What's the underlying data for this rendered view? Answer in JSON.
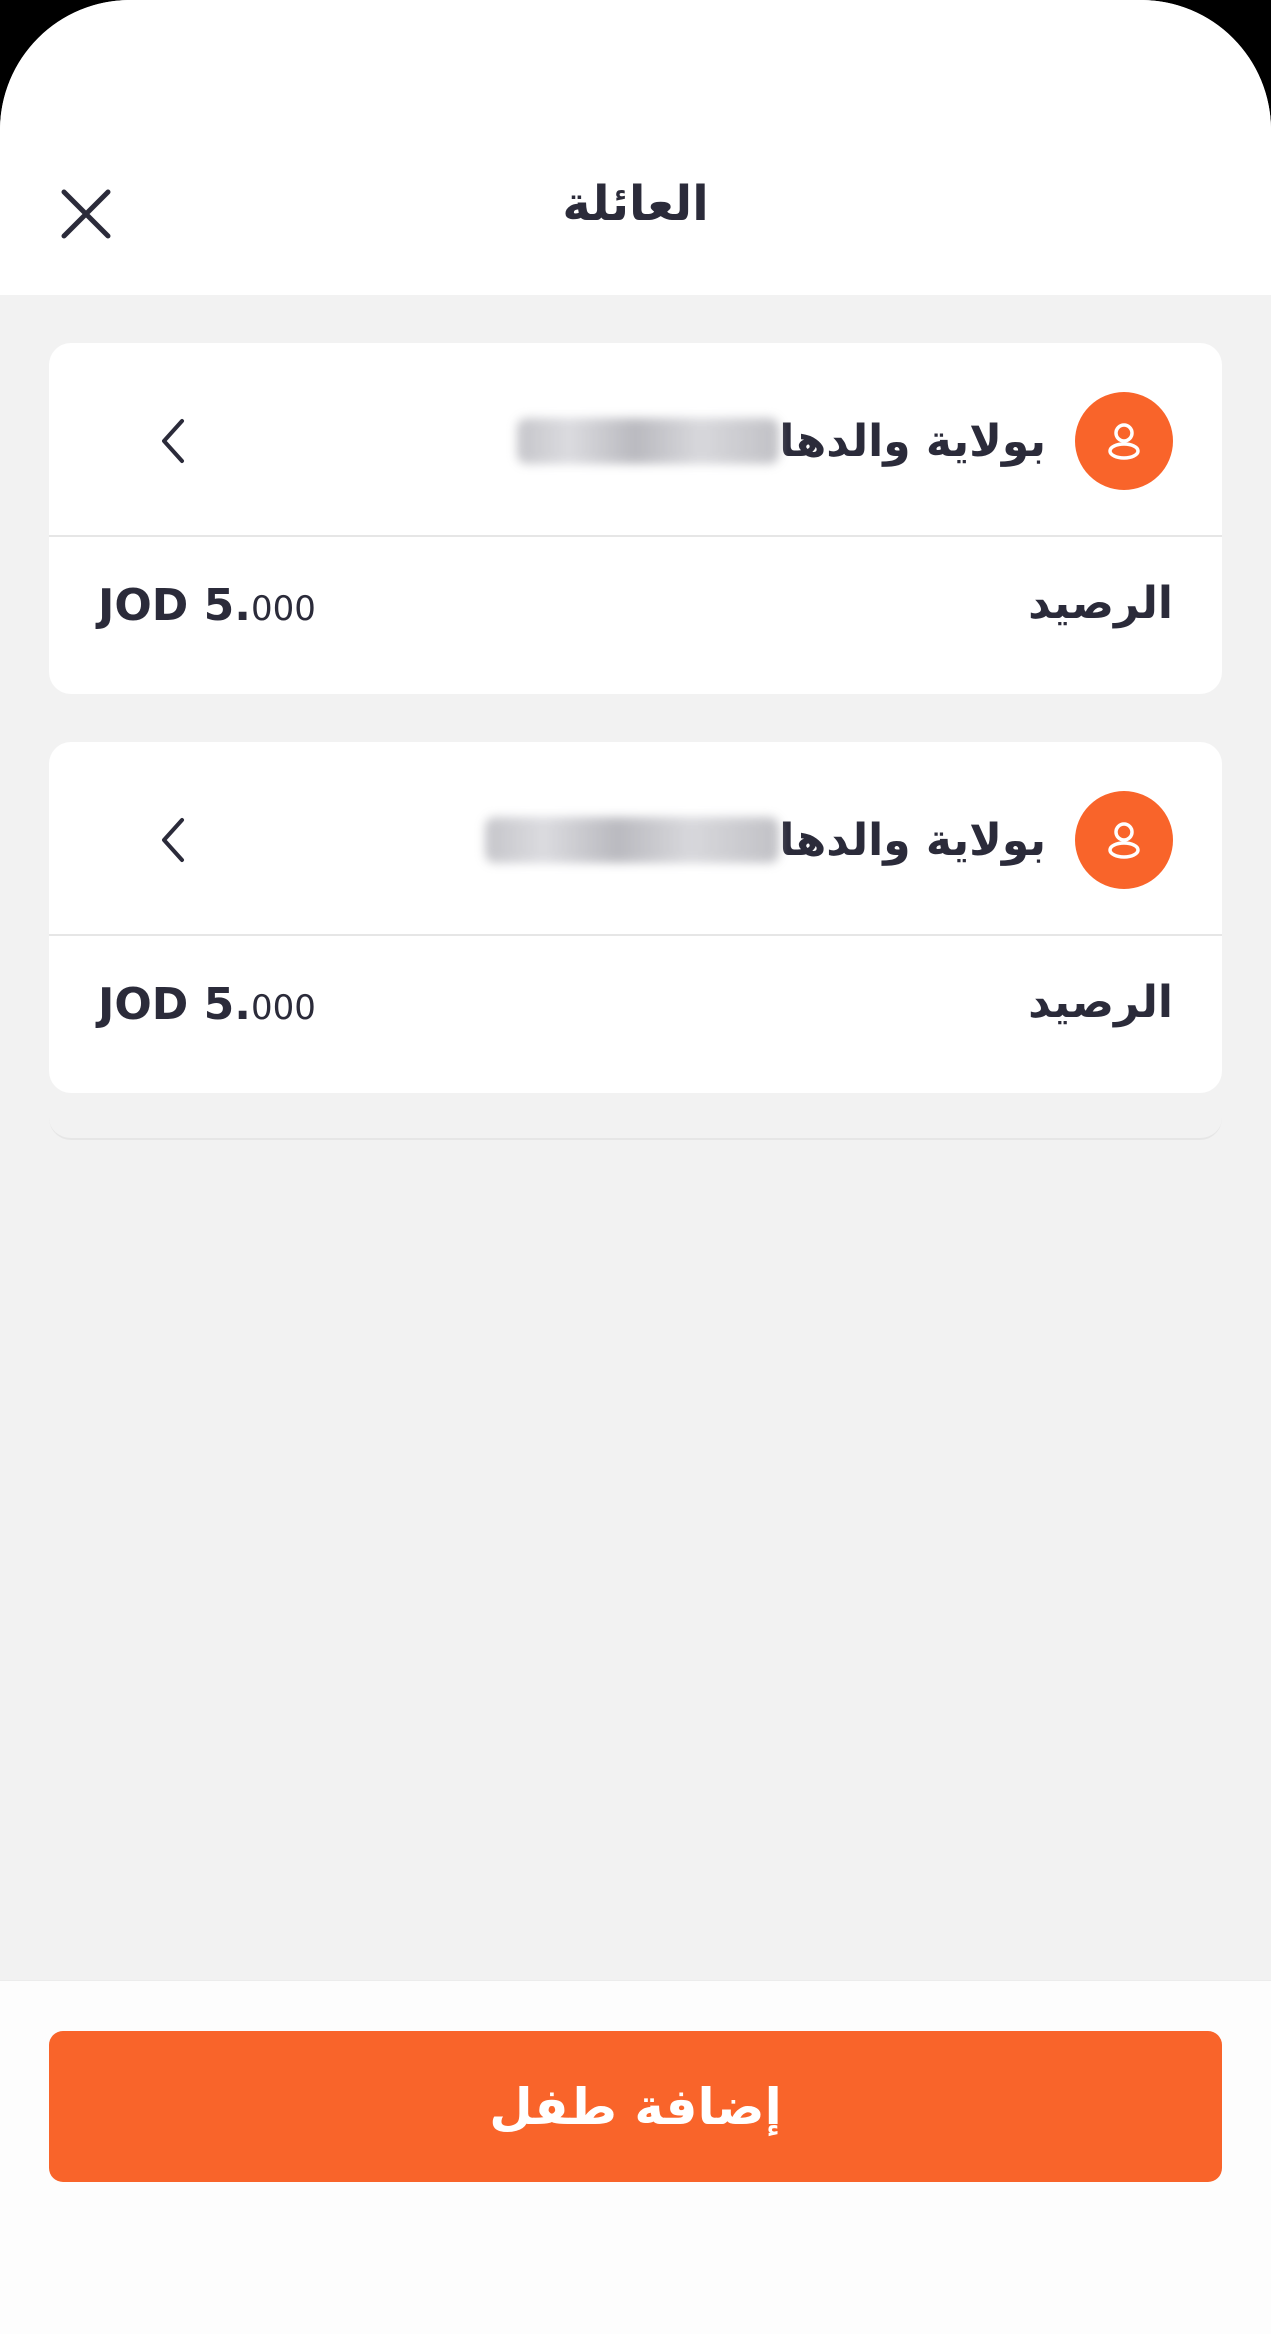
{
  "header": {
    "title": "العائلة"
  },
  "children": [
    {
      "name_suffix": "بولاية والدها",
      "balance_label": "الرصيد",
      "balance_currency": "JOD",
      "balance_whole": "5.",
      "balance_decimal": "000"
    },
    {
      "name_suffix": "بولاية والدها",
      "balance_label": "الرصيد",
      "balance_currency": "JOD",
      "balance_whole": "5.",
      "balance_decimal": "000"
    }
  ],
  "footer": {
    "add_child_label": "إضافة طفل"
  },
  "icons": {
    "close": "close-icon",
    "avatar": "user-icon",
    "chevron": "chevron-left-icon"
  },
  "colors": {
    "accent": "#f9642a",
    "text": "#2b2b3a",
    "background": "#f2f2f2",
    "card": "#ffffff"
  }
}
